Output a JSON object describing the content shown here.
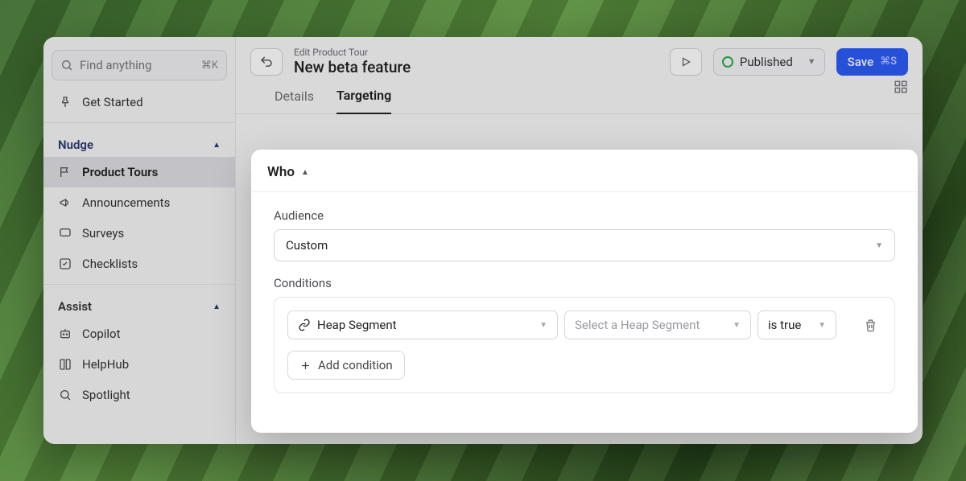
{
  "search": {
    "placeholder": "Find anything",
    "shortcut": "⌘K"
  },
  "sidebar": {
    "getStarted": "Get Started",
    "sectionNudge": "Nudge",
    "items": {
      "productTours": "Product Tours",
      "announcements": "Announcements",
      "surveys": "Surveys",
      "checklists": "Checklists"
    },
    "sectionAssist": "Assist",
    "assist": {
      "copilot": "Copilot",
      "helphub": "HelpHub",
      "spotlight": "Spotlight"
    }
  },
  "header": {
    "eyebrow": "Edit Product Tour",
    "title": "New beta feature",
    "status": "Published",
    "save": "Save",
    "saveShortcut": "⌘S"
  },
  "tabs": {
    "details": "Details",
    "targeting": "Targeting"
  },
  "card": {
    "title": "Who",
    "audienceLabel": "Audience",
    "audienceValue": "Custom",
    "conditionsLabel": "Conditions",
    "conditionType": "Heap Segment",
    "conditionPlaceholder": "Select a Heap Segment",
    "conditionOp": "is true",
    "addCondition": "Add condition"
  }
}
